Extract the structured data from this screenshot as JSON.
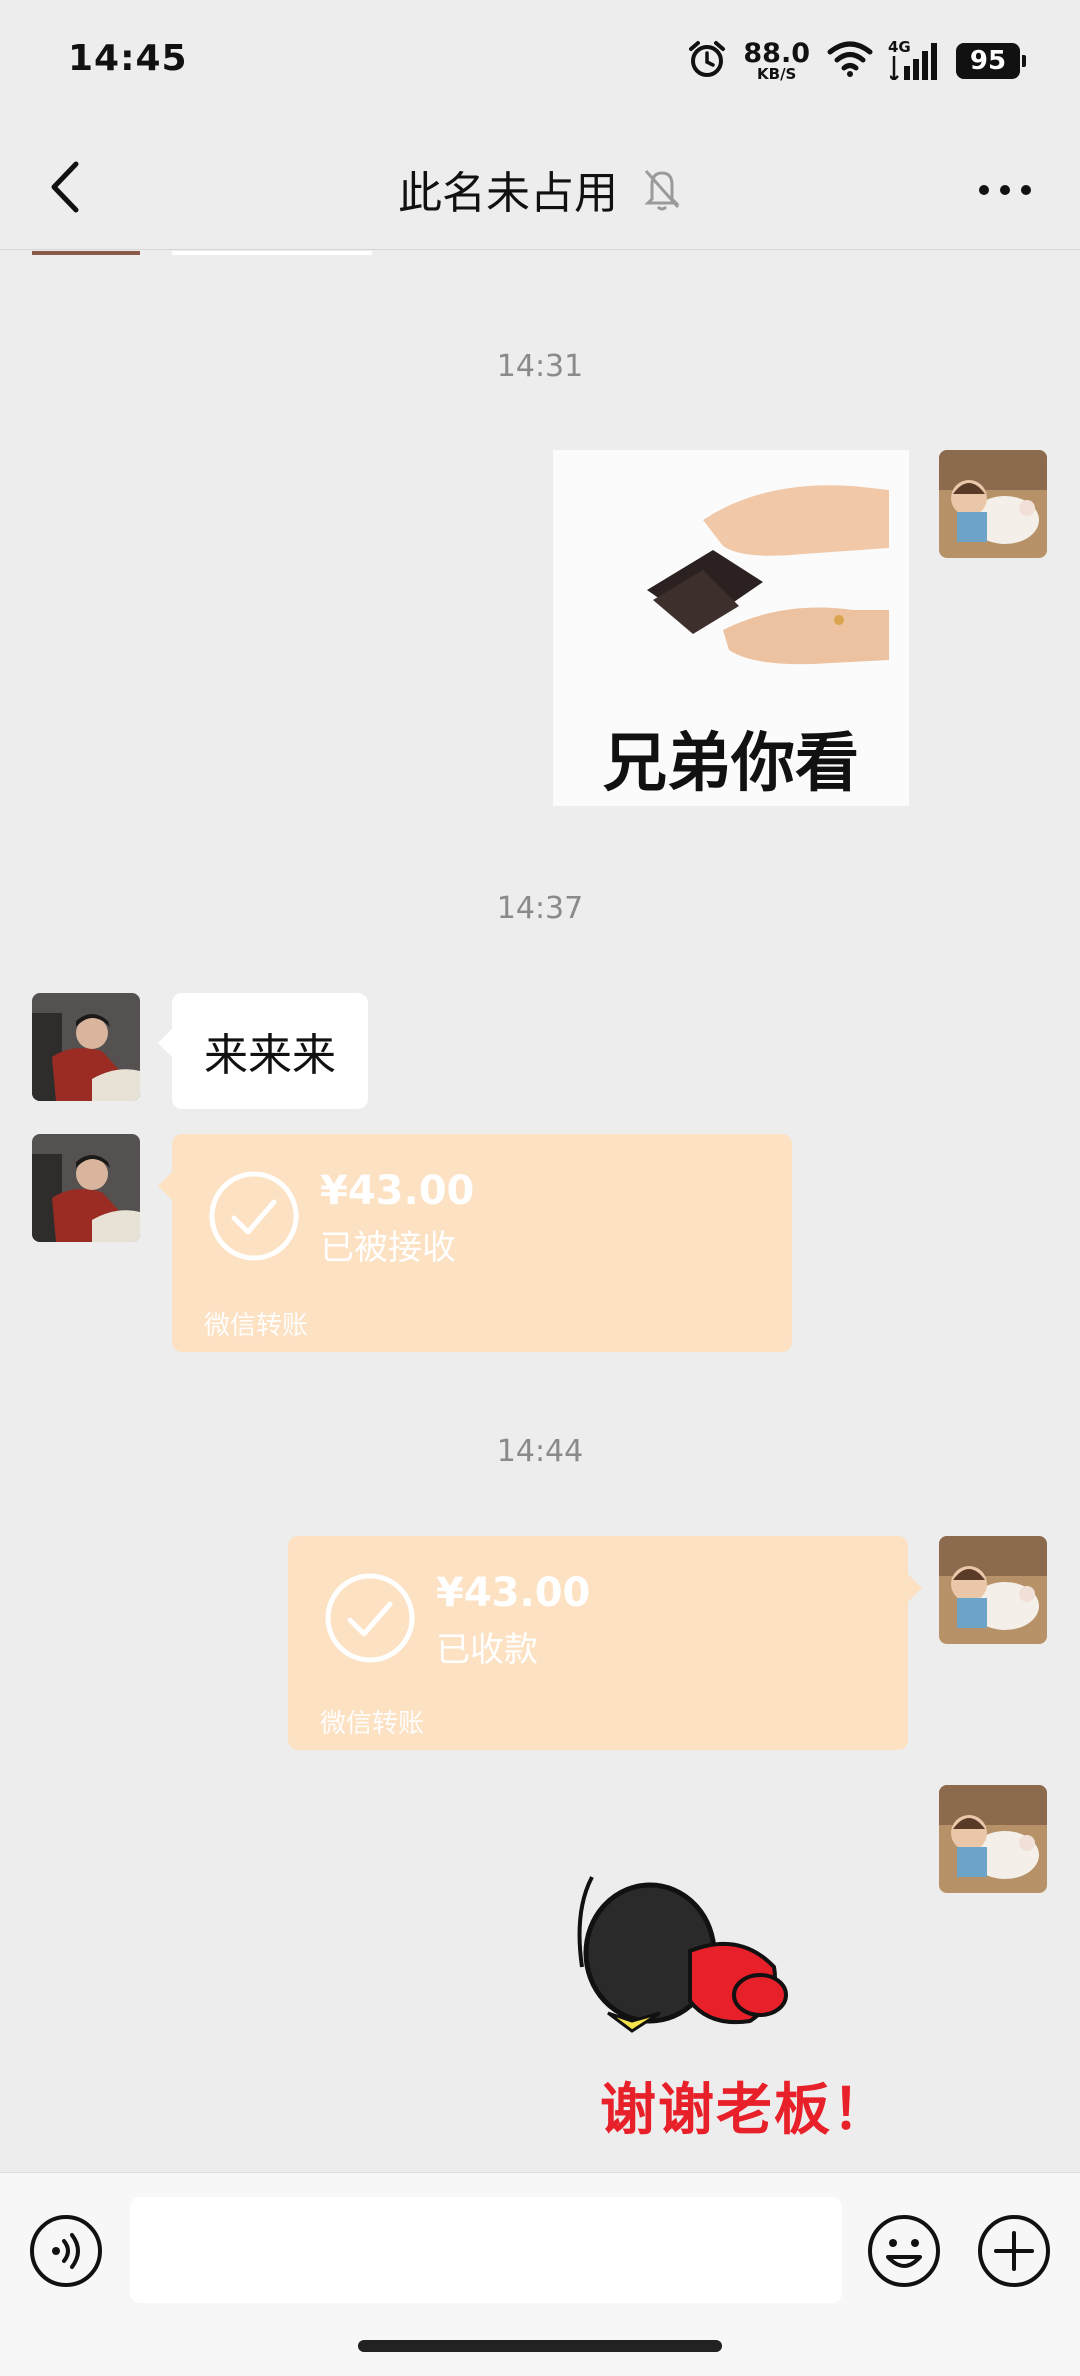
{
  "status_bar": {
    "time": "14:45",
    "net_speed": "88.0",
    "net_unit": "KB/S",
    "network_type": "4G",
    "battery": "95"
  },
  "header": {
    "title": "此名未占用",
    "back_icon": "chevron-left-icon",
    "mute_icon": "bell-off-icon",
    "more_icon": "more-horizontal-icon"
  },
  "messages": {
    "ts1": "14:31",
    "sticker1_caption": "兄弟你看",
    "ts2": "14:37",
    "text1": "来来来",
    "transfer1": {
      "amount": "¥43.00",
      "status": "已被接收",
      "footer": "微信转账"
    },
    "ts3": "14:44",
    "transfer2": {
      "amount": "¥43.00",
      "status": "已收款",
      "footer": "微信转账"
    },
    "sticker2_caption": "谢谢老板！"
  },
  "input_bar": {
    "placeholder": "",
    "voice_icon": "voice-icon",
    "emoji_icon": "emoji-icon",
    "plus_icon": "plus-icon"
  },
  "colors": {
    "background": "#ededed",
    "transfer_bg": "#fce1c3",
    "sticker_red": "#e8202a"
  }
}
